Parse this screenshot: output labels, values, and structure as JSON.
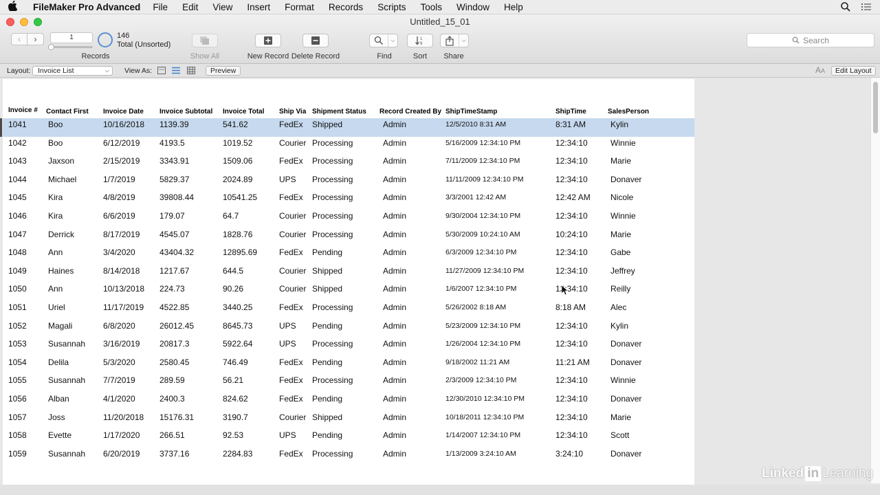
{
  "menubar": {
    "app_name": "FileMaker Pro Advanced",
    "items": [
      "File",
      "Edit",
      "View",
      "Insert",
      "Format",
      "Records",
      "Scripts",
      "Tools",
      "Window",
      "Help"
    ]
  },
  "window": {
    "title": "Untitled_15_01"
  },
  "toolbar": {
    "record_number": "1",
    "found_count": "146",
    "found_status": "Total (Unsorted)",
    "records_label": "Records",
    "show_all_label": "Show All",
    "new_record_label": "New Record",
    "delete_record_label": "Delete Record",
    "find_label": "Find",
    "sort_label": "Sort",
    "share_label": "Share",
    "search_placeholder": "Search"
  },
  "layout_bar": {
    "layout_label": "Layout:",
    "layout_value": "Invoice List",
    "view_as_label": "View As:",
    "preview_label": "Preview",
    "edit_layout_label": "Edit Layout"
  },
  "table": {
    "columns": [
      "Invoice #",
      "Contact First",
      "Invoice Date",
      "Invoice Subtotal",
      "Invoice Total",
      "Ship Via",
      "Shipment Status",
      "Record Created By",
      "ShipTimeStamp",
      "ShipTime",
      "SalesPerson"
    ],
    "rows": [
      [
        "1041",
        "Boo",
        "10/16/2018",
        "1139.39",
        "541.62",
        "FedEx",
        "Shipped",
        "Admin",
        "12/5/2010 8:31 AM",
        "8:31 AM",
        "Kylin"
      ],
      [
        "1042",
        "Boo",
        "6/12/2019",
        "4193.5",
        "1019.52",
        "Courier",
        "Processing",
        "Admin",
        "5/16/2009 12:34:10 PM",
        "12:34:10",
        "Winnie"
      ],
      [
        "1043",
        "Jaxson",
        "2/15/2019",
        "3343.91",
        "1509.06",
        "FedEx",
        "Processing",
        "Admin",
        "7/11/2009 12:34:10 PM",
        "12:34:10",
        "Marie"
      ],
      [
        "1044",
        "Michael",
        "1/7/2019",
        "5829.37",
        "2024.89",
        "UPS",
        "Processing",
        "Admin",
        "11/11/2009 12:34:10 PM",
        "12:34:10",
        "Donaver"
      ],
      [
        "1045",
        "Kira",
        "4/8/2019",
        "39808.44",
        "10541.25",
        "FedEx",
        "Processing",
        "Admin",
        "3/3/2001 12:42 AM",
        "12:42 AM",
        "Nicole"
      ],
      [
        "1046",
        "Kira",
        "6/6/2019",
        "179.07",
        "64.7",
        "Courier",
        "Processing",
        "Admin",
        "9/30/2004 12:34:10 PM",
        "12:34:10",
        "Winnie"
      ],
      [
        "1047",
        "Derrick",
        "8/17/2019",
        "4545.07",
        "1828.76",
        "Courier",
        "Processing",
        "Admin",
        "5/30/2009 10:24:10 AM",
        "10:24:10",
        "Marie"
      ],
      [
        "1048",
        "Ann",
        "3/4/2020",
        "43404.32",
        "12895.69",
        "FedEx",
        "Pending",
        "Admin",
        "6/3/2009 12:34:10 PM",
        "12:34:10",
        "Gabe"
      ],
      [
        "1049",
        "Haines",
        "8/14/2018",
        "1217.67",
        "644.5",
        "Courier",
        "Shipped",
        "Admin",
        "11/27/2009 12:34:10 PM",
        "12:34:10",
        "Jeffrey"
      ],
      [
        "1050",
        "Ann",
        "10/13/2018",
        "224.73",
        "90.26",
        "Courier",
        "Shipped",
        "Admin",
        "1/6/2007 12:34:10 PM",
        "12:34:10",
        "Reilly"
      ],
      [
        "1051",
        "Uriel",
        "11/17/2019",
        "4522.85",
        "3440.25",
        "FedEx",
        "Processing",
        "Admin",
        "5/26/2002 8:18 AM",
        "8:18 AM",
        "Alec"
      ],
      [
        "1052",
        "Magali",
        "6/8/2020",
        "26012.45",
        "8645.73",
        "UPS",
        "Pending",
        "Admin",
        "5/23/2009 12:34:10 PM",
        "12:34:10",
        "Kylin"
      ],
      [
        "1053",
        "Susannah",
        "3/16/2019",
        "20817.3",
        "5922.64",
        "UPS",
        "Processing",
        "Admin",
        "1/26/2004 12:34:10 PM",
        "12:34:10",
        "Donaver"
      ],
      [
        "1054",
        "Delila",
        "5/3/2020",
        "2580.45",
        "746.49",
        "FedEx",
        "Pending",
        "Admin",
        "9/18/2002 11:21 AM",
        "11:21 AM",
        "Donaver"
      ],
      [
        "1055",
        "Susannah",
        "7/7/2019",
        "289.59",
        "56.21",
        "FedEx",
        "Processing",
        "Admin",
        "2/3/2009 12:34:10 PM",
        "12:34:10",
        "Winnie"
      ],
      [
        "1056",
        "Alban",
        "4/1/2020",
        "2400.3",
        "824.62",
        "FedEx",
        "Pending",
        "Admin",
        "12/30/2010 12:34:10 PM",
        "12:34:10",
        "Donaver"
      ],
      [
        "1057",
        "Joss",
        "11/20/2018",
        "15176.31",
        "3190.7",
        "Courier",
        "Shipped",
        "Admin",
        "10/18/2011 12:34:10 PM",
        "12:34:10",
        "Marie"
      ],
      [
        "1058",
        "Evette",
        "1/17/2020",
        "266.51",
        "92.53",
        "UPS",
        "Pending",
        "Admin",
        "1/14/2007 12:34:10 PM",
        "12:34:10",
        "Scott"
      ],
      [
        "1059",
        "Susannah",
        "6/20/2019",
        "3737.16",
        "2284.83",
        "FedEx",
        "Processing",
        "Admin",
        "1/13/2009 3:24:10 AM",
        "3:24:10",
        "Donaver"
      ]
    ],
    "selected_row": 0
  },
  "watermark": {
    "part1": "Linked",
    "part2": "in",
    "part3": "Learning"
  },
  "colors": {
    "selection": "#c6d9ee",
    "pie_ring": "#5a8fd1"
  }
}
